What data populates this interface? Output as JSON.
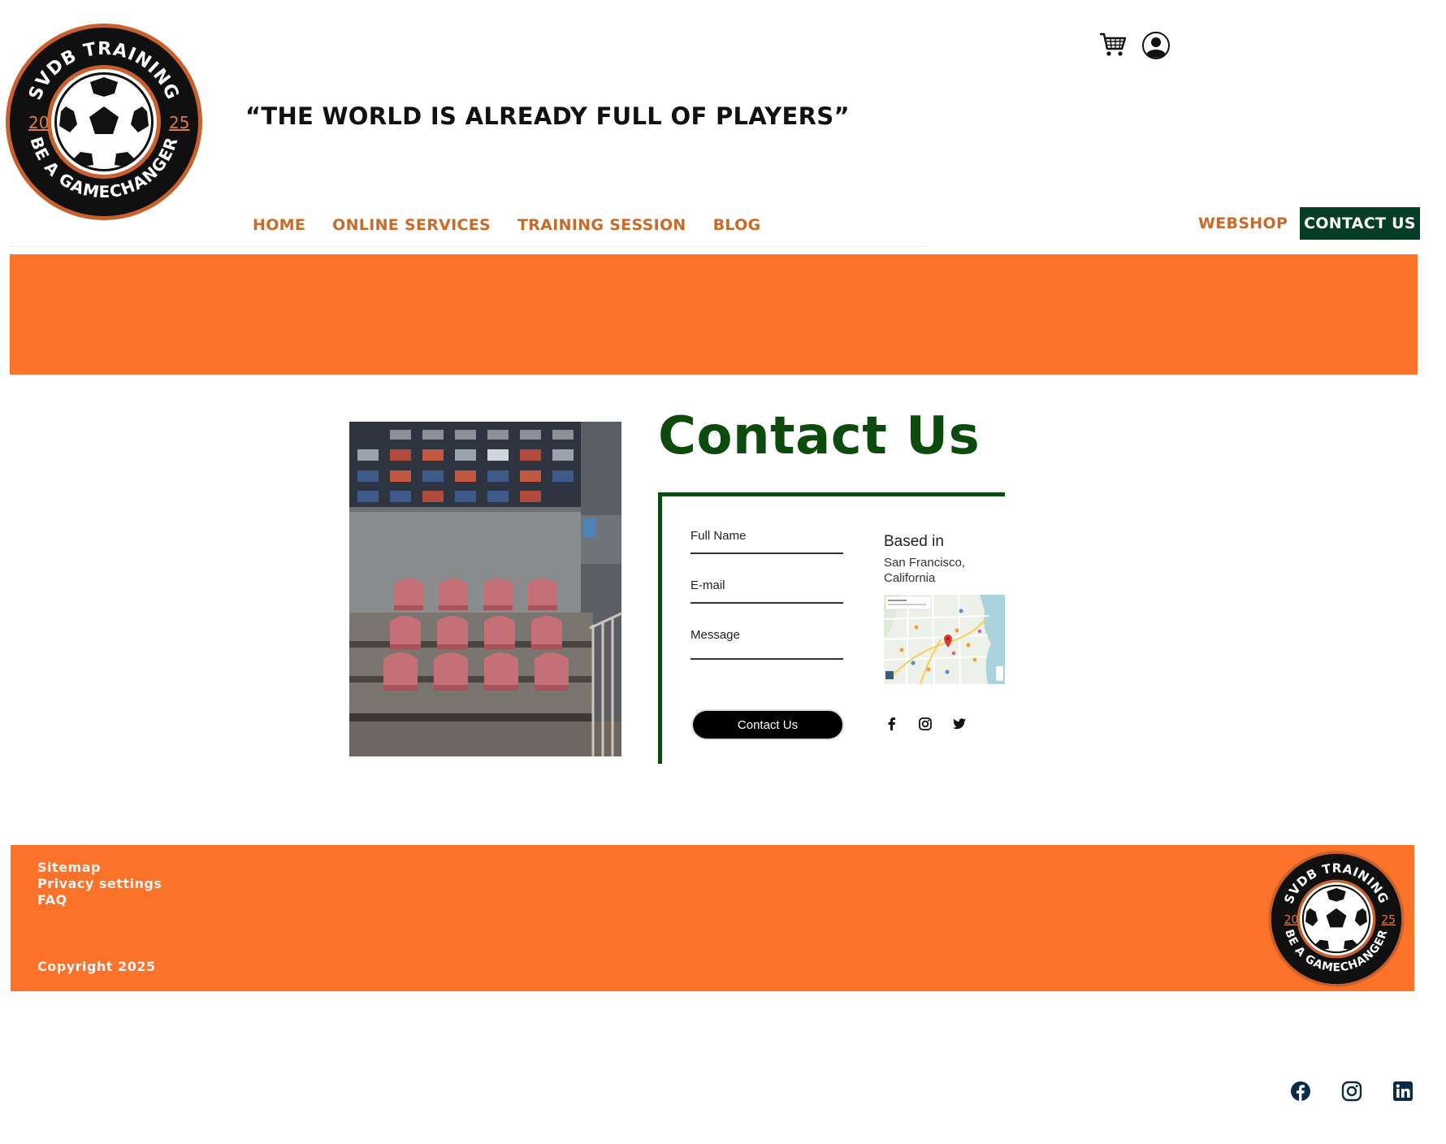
{
  "brand": {
    "logo_top": "SVDB TRAINING",
    "logo_bottom": "BE A GAMECHANGER",
    "logo_year_left": "20",
    "logo_year_right": "25",
    "accent": "#fc7228",
    "dark_green": "#053d26"
  },
  "header": {
    "tagline": "“THE WORLD IS ALREADY FULL OF PLAYERS”",
    "icons": [
      "cart-icon",
      "user-icon"
    ]
  },
  "nav": {
    "items": [
      "HOME",
      "ONLINE SERVICES",
      "TRAINING SESSION",
      "BLOG"
    ],
    "webshop": "WEBSHOP",
    "contact": "CONTACT US"
  },
  "contact": {
    "title": "Contact Us",
    "fields": {
      "full_name": "Full Name",
      "email": "E-mail",
      "message": "Message"
    },
    "submit": "Contact Us",
    "based_label": "Based in",
    "city": "San Francisco, California",
    "social": [
      "facebook-icon",
      "instagram-icon",
      "twitter-icon"
    ]
  },
  "footer": {
    "links": [
      "Sitemap",
      "Privacy settings",
      "FAQ"
    ],
    "copyright": "Copyright 2025"
  },
  "bottom_social": [
    "facebook-icon",
    "instagram-icon",
    "linkedin-icon"
  ]
}
